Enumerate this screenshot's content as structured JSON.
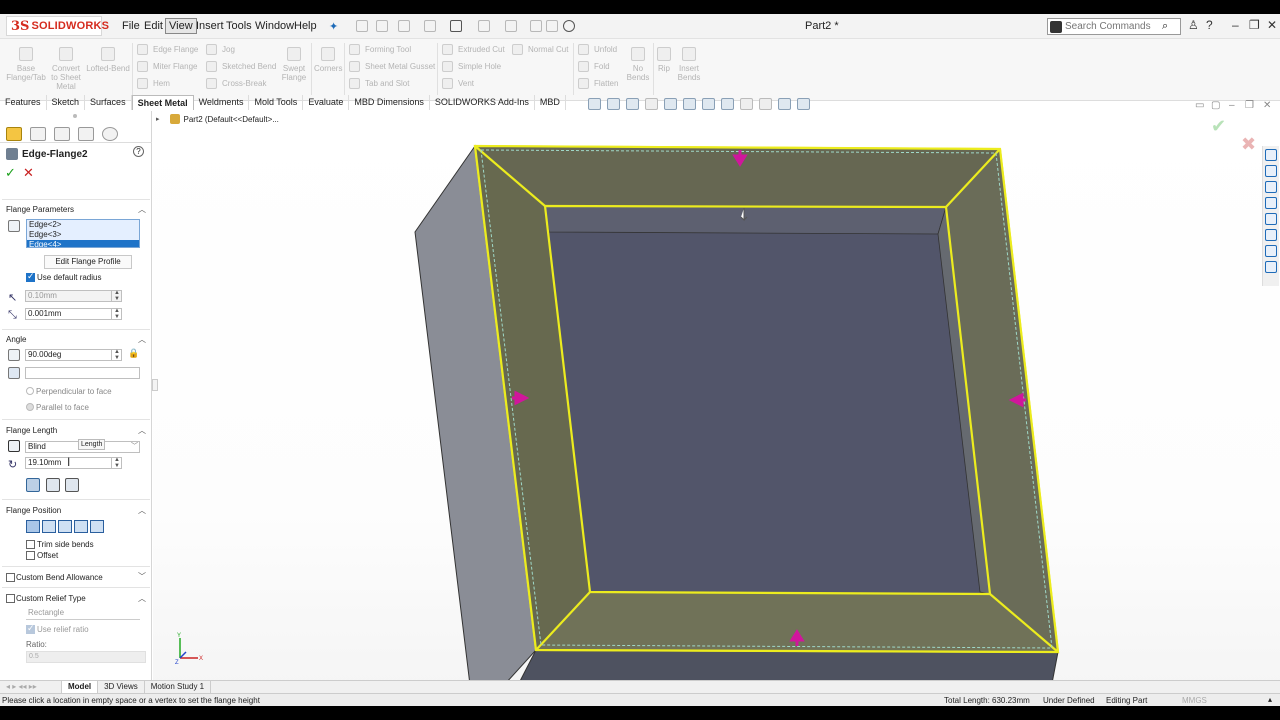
{
  "app": {
    "brand_ds": "3S",
    "brand_name": "SOLIDWORKS",
    "doc_title": "Part2 *"
  },
  "menu": [
    "File",
    "Edit",
    "View",
    "Insert",
    "Tools",
    "Window",
    "Help"
  ],
  "search": {
    "placeholder": "Search Commands"
  },
  "ribbon": {
    "base_flange": "Base Flange/Tab",
    "convert": "Convert to Sheet Metal",
    "lofted": "Lofted-Bend",
    "edge_flange": "Edge Flange",
    "miter_flange": "Miter Flange",
    "hem": "Hem",
    "jog": "Jog",
    "sketched_bend": "Sketched Bend",
    "cross_break": "Cross-Break",
    "swept_flange": "Swept Flange",
    "corners": "Corners",
    "forming_tool": "Forming Tool",
    "gusset": "Sheet Metal Gusset",
    "tab_slot": "Tab and Slot",
    "extruded_cut": "Extruded Cut",
    "simple_hole": "Simple Hole",
    "vent": "Vent",
    "normal_cut": "Normal Cut",
    "unfold": "Unfold",
    "fold": "Fold",
    "flatten": "Flatten",
    "no_bends": "No Bends",
    "rip": "Rip",
    "insert_bends": "Insert Bends"
  },
  "tabs": [
    "Features",
    "Sketch",
    "Surfaces",
    "Sheet Metal",
    "Weldments",
    "Mold Tools",
    "Evaluate",
    "MBD Dimensions",
    "SOLIDWORKS Add-Ins",
    "MBD"
  ],
  "tree": {
    "label": "Part2  (Default<<Default>..."
  },
  "property_manager": {
    "title": "Edge-Flange2",
    "flange_parameters": {
      "header": "Flange Parameters",
      "edges": [
        "Edge<2>",
        "Edge<3>",
        "Edge<4>"
      ],
      "edit_profile": "Edit Flange Profile",
      "use_default_radius": "Use default radius",
      "radius": "0.10mm",
      "gap": "0.001mm"
    },
    "angle": {
      "header": "Angle",
      "value": "90.00deg",
      "perpendicular": "Perpendicular to face",
      "parallel": "Parallel to face"
    },
    "flange_length": {
      "header": "Flange Length",
      "end_condition": "Blind",
      "tooltip": "Length",
      "value": "19.10mm"
    },
    "flange_position": {
      "header": "Flange Position",
      "trim_side_bends": "Trim side bends",
      "offset": "Offset"
    },
    "custom_bend_allowance": "Custom Bend Allowance",
    "custom_relief": {
      "header": "Custom Relief Type",
      "type": "Rectangle",
      "use_relief_ratio": "Use relief ratio",
      "ratio_label": "Ratio:",
      "ratio_value": "0.5"
    }
  },
  "bottom_tabs": [
    "Model",
    "3D Views",
    "Motion Study 1"
  ],
  "status": {
    "message": "Please click a location in empty space or a vertex to set the flange height",
    "total_length": "Total Length: 630.23mm",
    "defined": "Under Defined",
    "mode": "Editing Part",
    "units": "MMGS"
  },
  "colors": {
    "brand_red": "#d52b1e",
    "selection_yellow": "#e8e820",
    "arrow_magenta": "#d0169c",
    "model_gray": "#5c5f6b",
    "ok_green": "#1ba01b"
  }
}
